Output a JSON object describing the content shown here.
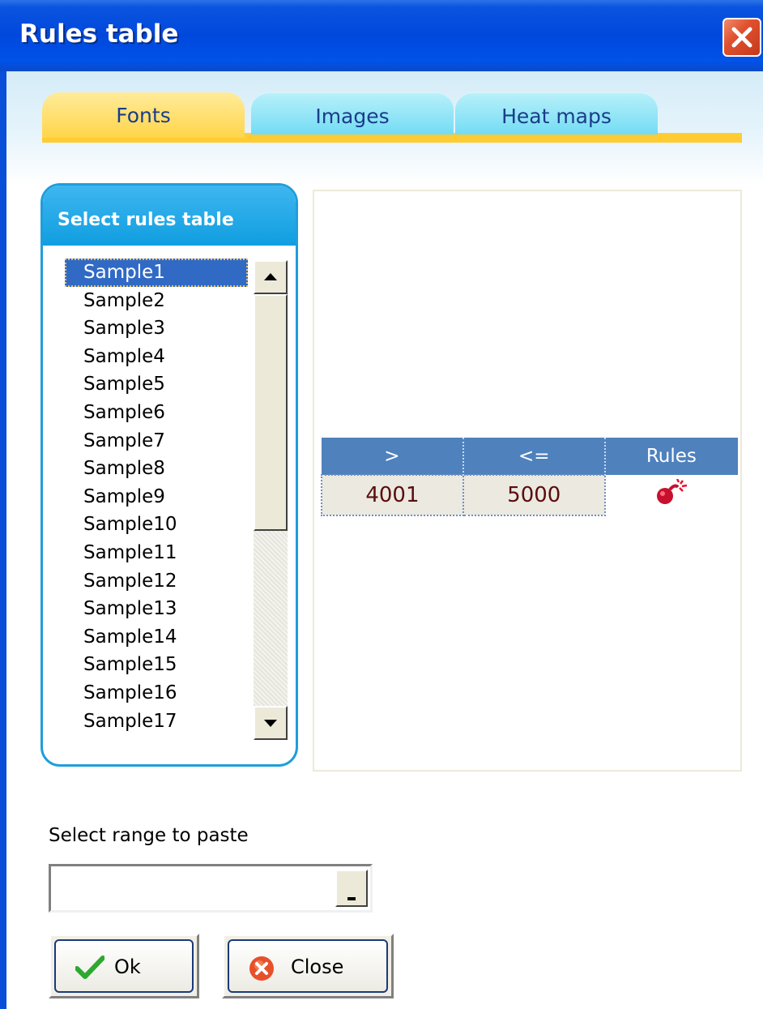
{
  "window": {
    "title": "Rules table"
  },
  "tabs": [
    {
      "label": "Fonts",
      "active": true
    },
    {
      "label": "Images",
      "active": false
    },
    {
      "label": "Heat maps",
      "active": false
    }
  ],
  "panel": {
    "title": "Select rules table",
    "items": [
      "Sample1",
      "Sample2",
      "Sample3",
      "Sample4",
      "Sample5",
      "Sample6",
      "Sample7",
      "Sample8",
      "Sample9",
      "Sample10",
      "Sample11",
      "Sample12",
      "Sample13",
      "Sample14",
      "Sample15",
      "Sample16",
      "Sample17"
    ],
    "selected_index": 0
  },
  "rules_table": {
    "headers": [
      ">",
      "<=",
      "Rules"
    ],
    "rows": [
      {
        "gt": "4001",
        "lte": "5000",
        "rule_icon": "bomb-icon"
      }
    ]
  },
  "range": {
    "label": "Select range to paste",
    "value": ""
  },
  "buttons": {
    "ok": "Ok",
    "close": "Close"
  },
  "colors": {
    "title_bar": "#0048dc",
    "tab_active": "#ffd54a",
    "tab_inactive": "#73dcf4",
    "panel_accent": "#1f9edb",
    "table_header": "#4f81bd",
    "selection": "#316ac5"
  }
}
